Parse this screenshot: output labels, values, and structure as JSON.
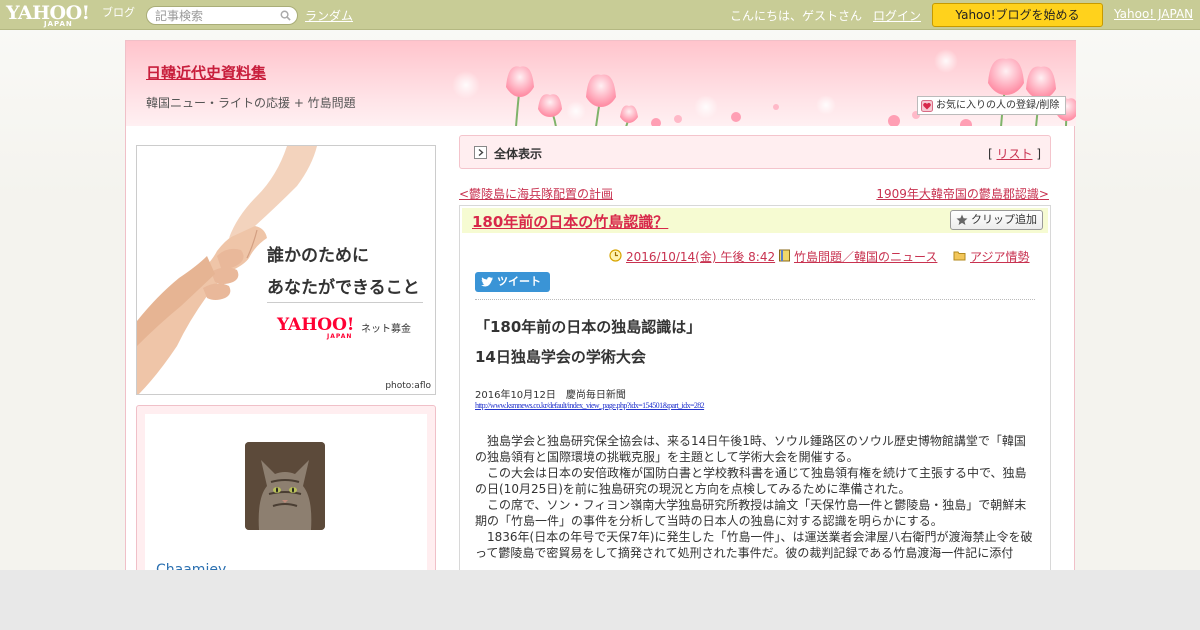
{
  "topbar": {
    "logo": "YAHOO!",
    "logo_sub": "JAPAN",
    "logo_blog": "ブログ",
    "search_placeholder": "記事検索",
    "random_link": "ランダム",
    "greeting": "こんにちは、ゲストさん",
    "login_link": "ログイン",
    "start_button": "Yahoo!ブログを始める",
    "yahoo_japan_link": "Yahoo! JAPAN"
  },
  "header": {
    "blog_title": "日韓近代史資料集",
    "blog_desc": "韓国ニュー・ライトの応援 + 竹島問題",
    "fav_button": "お気に入りの人の登録/削除"
  },
  "sidebar": {
    "banner": {
      "line1": "誰かのために",
      "line2": "あなたができること",
      "brand": "YAHOO!",
      "brand_sub": "JAPAN",
      "service": "ネット募金",
      "credit": "photo:aflo"
    },
    "profile": {
      "name": "Chaamiey"
    }
  },
  "main": {
    "viewall_label": "全体表示",
    "list_prefix": "[ ",
    "list_link": "リスト",
    "list_suffix": " ]",
    "prev_link": "<鬱陵島に海兵隊配置の計画",
    "next_link": "1909年大韓帝国の鬱島郡認識>",
    "article": {
      "title": "180年前の日本の竹島認識？",
      "clip_button": "クリップ追加",
      "datetime": "2016/10/14(金) 午後 8:42",
      "category": "竹島問題／韓国のニュース",
      "folder": "アジア情勢",
      "tweet_button": "ツイート",
      "heading1": "「180年前の日本の独島認識は」",
      "heading2": "14日独島学会の学術大会",
      "source_line": "2016年10月12日　慶尚毎日新聞",
      "source_url": "http://www.ksmnews.co.kr/default/index_view_page.php?idx=154501&part_idx=282",
      "paragraphs": [
        "独島学会と独島研究保全協会は、来る14日午後1時、ソウル鍾路区のソウル歴史博物館講堂で「韓国の独島領有と国際環境の挑戦克服」を主題として学術大会を開催する。",
        "この大会は日本の安倍政権が国防白書と学校教科書を通じて独島領有権を続けて主張する中で、独島の日(10月25日)を前に独島研究の現況と方向を点検してみるために準備された。",
        "この席で、ソン・フィヨン嶺南大学独島研究所教授は論文「天保竹島一件と鬱陵島・独島」で朝鮮末期の「竹島一件」の事件を分析して当時の日本人の独島に対する認識を明らかにする。",
        "1836年(日本の年号で天保7年)に発生した「竹島一件」、は運送業者会津屋八右衛門が渡海禁止令を破って鬱陵島で密貿易をして摘発されて処刑された事件だ。彼の裁判記録である竹島渡海一件記に添付"
      ]
    }
  },
  "colors": {
    "topbar_bg": "#c8cc96",
    "accent_link": "#c83250",
    "start_button": "#ffd21c",
    "header_pink": "#ffc4cc",
    "tweet_blue": "#3a94d6"
  }
}
